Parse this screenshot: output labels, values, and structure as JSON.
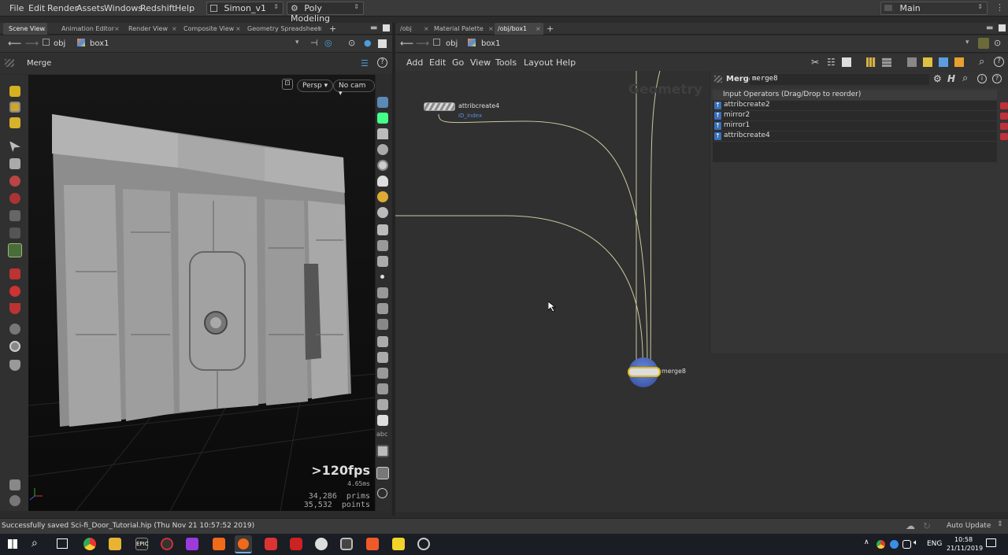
{
  "menubar": {
    "items": [
      "File",
      "Edit",
      "Render",
      "Assets",
      "Windows",
      "Redshift",
      "Help"
    ],
    "desktop": "Simon_v1",
    "shelf": "Poly Modeling",
    "workspace": "Main"
  },
  "left_pane": {
    "tabs": [
      "Scene View",
      "Animation Editor",
      "Render View",
      "Composite View",
      "Geometry Spreadsheet"
    ],
    "path": [
      "obj",
      "box1"
    ],
    "title": "Merge",
    "camera_buttons": [
      "Persp",
      "No cam"
    ],
    "hud": {
      "fps": ">120fps",
      "ms": "4.65ms",
      "prims": "34,286  prims",
      "points": "35,532  points"
    }
  },
  "right_pane": {
    "tabs": [
      "/obj",
      "Material Palette",
      "/obj/box1"
    ],
    "path": [
      "obj",
      "box1"
    ],
    "menu": [
      "Add",
      "Edit",
      "Go",
      "View",
      "Tools",
      "Layout",
      "Help"
    ],
    "watermark": "Geometry",
    "nodes": {
      "attrib": {
        "name": "attribcreate4",
        "sub": "ID_index"
      },
      "merge": {
        "name": "merge8"
      }
    }
  },
  "params": {
    "type": "Merge",
    "node_name": "merge8",
    "section_title": "Input Operators (Drag/Drop to reorder)",
    "inputs": [
      "attribcreate2",
      "mirror2",
      "mirror1",
      "attribcreate4"
    ]
  },
  "status": {
    "message": "Successfully saved Sci-fi_Door_Tutorial.hip (Thu Nov 21 10:57:52 2019)",
    "update_mode": "Auto Update"
  },
  "taskbar": {
    "lang": "ENG",
    "time": "10:58",
    "date": "21/11/2019"
  },
  "colors": {
    "accent_blue": "#3b6fb8",
    "wire": "#c9c9a0",
    "remove_red": "#c0303a"
  }
}
